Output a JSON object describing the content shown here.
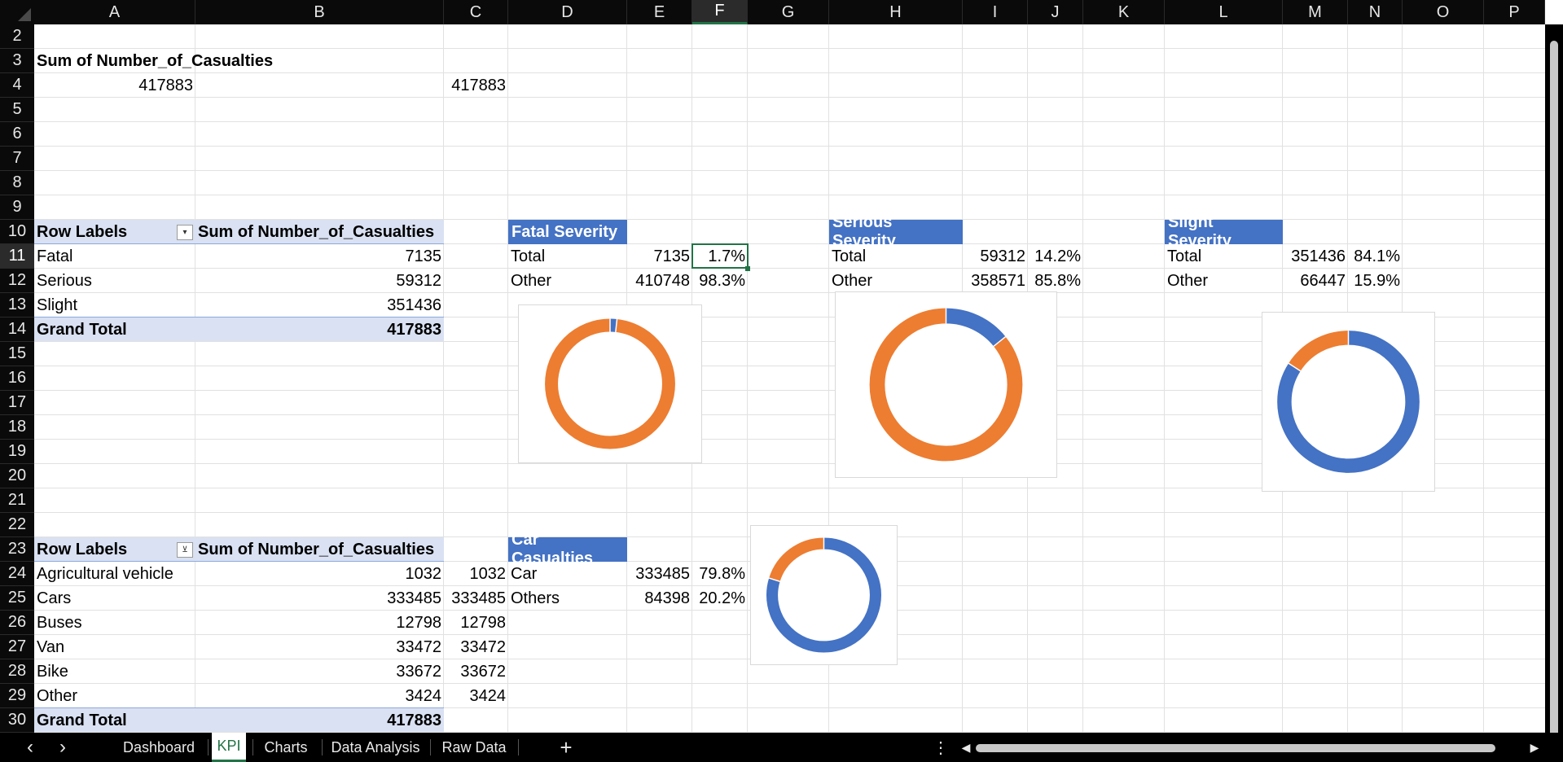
{
  "columns": [
    "A",
    "B",
    "C",
    "D",
    "E",
    "F",
    "G",
    "H",
    "I",
    "J",
    "K",
    "L",
    "M",
    "N",
    "O",
    "P"
  ],
  "rows": [
    "2",
    "3",
    "4",
    "5",
    "6",
    "7",
    "8",
    "9",
    "10",
    "11",
    "12",
    "13",
    "14",
    "15",
    "16",
    "17",
    "18",
    "19",
    "20",
    "21",
    "22",
    "23",
    "24",
    "25",
    "26",
    "27",
    "28",
    "29",
    "30"
  ],
  "selected_cell": {
    "column": "F",
    "row": "11"
  },
  "cells": {
    "a3": "Sum of Number_of_Casualties",
    "a4": "417883",
    "c4": "417883",
    "a10": "Row Labels",
    "b10": "Sum of Number_of_Casualties",
    "a11": "Fatal",
    "b11": "7135",
    "a12": "Serious",
    "b12": "59312",
    "a13": "Slight",
    "b13": "351436",
    "a14": "Grand Total",
    "b14": "417883",
    "d10": "Fatal Severity",
    "d11": "Total",
    "e11": "7135",
    "f11": "1.7%",
    "d12": "Other",
    "e12": "410748",
    "f12": "98.3%",
    "h10": "Serious Severity",
    "h11": "Total",
    "i11": "59312",
    "j11": "14.2%",
    "h12": "Other",
    "i12": "358571",
    "j12": "85.8%",
    "l10": "Slight Severity",
    "l11": "Total",
    "m11": "351436",
    "n11": "84.1%",
    "l12": "Other",
    "m12": "66447",
    "n12": "15.9%",
    "a23": "Row Labels",
    "b23": "Sum of Number_of_Casualties",
    "a24": "Agricultural vehicle",
    "b24": "1032",
    "c24": "1032",
    "a25": "Cars",
    "b25": "333485",
    "c25": "333485",
    "a26": "Buses",
    "b26": "12798",
    "c26": "12798",
    "a27": "Van",
    "b27": "33472",
    "c27": "33472",
    "a28": "Bike",
    "b28": "33672",
    "c28": "33672",
    "a29": "Other",
    "b29": "3424",
    "c29": "3424",
    "a30": "Grand Total",
    "b30": "417883",
    "d23": "Car Casualties",
    "d24": "Car",
    "e24": "333485",
    "f24": "79.8%",
    "d25": "Others",
    "e25": "84398",
    "f25": "20.2%"
  },
  "colors": {
    "blue": "#4472c4",
    "orange": "#ed7d31",
    "accent": "#217346"
  },
  "chart_data": [
    {
      "type": "pie",
      "donut": true,
      "labels": [
        "Total",
        "Other"
      ],
      "values": [
        1.7,
        98.3
      ],
      "colors": [
        "#4472c4",
        "#ed7d31"
      ]
    },
    {
      "type": "pie",
      "donut": true,
      "labels": [
        "Total",
        "Other"
      ],
      "values": [
        14.2,
        85.8
      ],
      "colors": [
        "#4472c4",
        "#ed7d31"
      ]
    },
    {
      "type": "pie",
      "donut": true,
      "labels": [
        "Total",
        "Other"
      ],
      "values": [
        84.1,
        15.9
      ],
      "colors": [
        "#4472c4",
        "#ed7d31"
      ]
    },
    {
      "type": "pie",
      "donut": true,
      "labels": [
        "Car",
        "Others"
      ],
      "values": [
        79.8,
        20.2
      ],
      "colors": [
        "#4472c4",
        "#ed7d31"
      ]
    }
  ],
  "tabs": [
    "Dashboard",
    "KPI",
    "Charts",
    "Data Analysis",
    "Raw Data"
  ],
  "active_tab": "KPI",
  "new_sheet_label": "+",
  "more_icon": "⋮",
  "nav_prev": "‹",
  "nav_next": "›",
  "scroll_left": "◀",
  "scroll_right": "▶"
}
